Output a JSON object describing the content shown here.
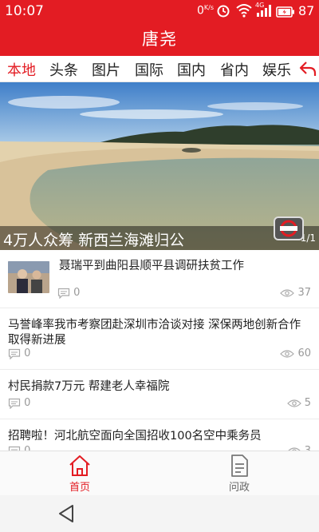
{
  "status_bar": {
    "time": "10:07",
    "net_speed": "0",
    "net_unit": "K/s",
    "signal_label": "4G",
    "battery": "87"
  },
  "app": {
    "title": "唐尧"
  },
  "tabs": [
    {
      "label": "本地",
      "active": true
    },
    {
      "label": "头条",
      "active": false
    },
    {
      "label": "图片",
      "active": false
    },
    {
      "label": "国际",
      "active": false
    },
    {
      "label": "国内",
      "active": false
    },
    {
      "label": "省内",
      "active": false
    },
    {
      "label": "娱乐",
      "active": false
    }
  ],
  "hero": {
    "caption": "4万人众筹 新西兰海滩归公",
    "counter": "1/1"
  },
  "news": [
    {
      "title": "聂瑞平到曲阳县顺平县调研扶贫工作",
      "comments": "0",
      "views": "37",
      "has_thumb": true
    },
    {
      "title": "马誉峰率我市考察团赴深圳市洽谈对接 深保两地创新合作取得新进展",
      "comments": "0",
      "views": "60",
      "has_thumb": false
    },
    {
      "title": "村民捐款7万元 帮建老人幸福院",
      "comments": "0",
      "views": "5",
      "has_thumb": false
    },
    {
      "title": "招聘啦！河北航空面向全国招收100名空中乘务员",
      "comments": "0",
      "views": "3",
      "has_thumb": false
    }
  ],
  "bottom_nav": [
    {
      "label": "首页",
      "icon": "home-icon",
      "active": true
    },
    {
      "label": "问政",
      "icon": "document-icon",
      "active": false
    }
  ],
  "colors": {
    "accent": "#e31c23",
    "muted": "#999999"
  }
}
